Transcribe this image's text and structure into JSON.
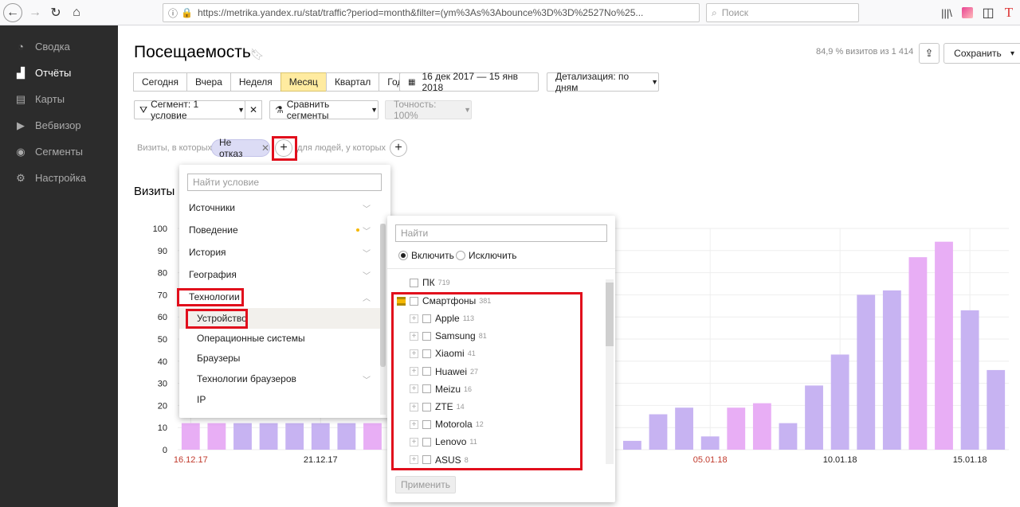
{
  "browser": {
    "url": "https://metrika.yandex.ru/stat/traffic?period=month&filter=(ym%3As%3Abounce%3D%3D%2527No%25...",
    "search_placeholder": "Поиск"
  },
  "sidebar": {
    "items": [
      {
        "label": "Сводка",
        "icon": "gauge-icon",
        "active": false
      },
      {
        "label": "Отчёты",
        "icon": "bar-chart-icon",
        "active": true
      },
      {
        "label": "Карты",
        "icon": "map-icon",
        "active": false
      },
      {
        "label": "Вебвизор",
        "icon": "play-icon",
        "active": false
      },
      {
        "label": "Сегменты",
        "icon": "segments-icon",
        "active": false
      },
      {
        "label": "Настройка",
        "icon": "gear-icon",
        "active": false
      }
    ]
  },
  "header": {
    "title": "Посещаемость",
    "visits_pct": "84,9 % визитов из 1 414",
    "save_label": "Сохранить"
  },
  "period": {
    "options": [
      "Сегодня",
      "Вчера",
      "Неделя",
      "Месяц",
      "Квартал",
      "Год"
    ],
    "selected": "Месяц",
    "date_range": "16 дек 2017 — 15 янв 2018",
    "detail": "Детализация: по дням"
  },
  "filters": {
    "segment": "Сегмент: 1 условие",
    "compare": "Сравнить сегменты",
    "accuracy": "Точность: 100%",
    "visits_label": "Визиты, в которых",
    "chip": "Не отказ",
    "people_label": "для людей, у которых"
  },
  "chart_title": "Визиты",
  "chart_data": {
    "type": "bar",
    "y_ticks": [
      "0",
      "10",
      "20",
      "30",
      "40",
      "50",
      "60",
      "70",
      "80",
      "90",
      "100"
    ],
    "ylim": [
      0,
      100
    ],
    "x_labels": [
      {
        "label": "16.12.17",
        "index": 0,
        "color": "#c0392b"
      },
      {
        "label": "21.12.17",
        "index": 5,
        "color": "#222"
      },
      {
        "label": "05.01.18",
        "index": 20,
        "color": "#c0392b"
      },
      {
        "label": "10.01.18",
        "index": 25,
        "color": "#222"
      },
      {
        "label": "15.01.18",
        "index": 30,
        "color": "#222"
      }
    ],
    "values": [
      12,
      12,
      12,
      12,
      12,
      12,
      12,
      12,
      null,
      null,
      null,
      null,
      null,
      null,
      null,
      null,
      null,
      4,
      16,
      19,
      6,
      19,
      21,
      12,
      29,
      43,
      70,
      72,
      87,
      94,
      63,
      36
    ],
    "weekend_indices": [
      0,
      1,
      7,
      8,
      14,
      15,
      21,
      22,
      28,
      29
    ]
  },
  "dropdown_groups": {
    "search_placeholder": "Найти условие",
    "items": [
      {
        "label": "Источники",
        "sub": false,
        "chev": "⌄"
      },
      {
        "label": "Поведение",
        "sub": false,
        "chev": "⌄"
      },
      {
        "label": "История",
        "sub": false,
        "chev": "⌄"
      },
      {
        "label": "География",
        "sub": false,
        "chev": "⌄"
      },
      {
        "label": "Технологии",
        "sub": false,
        "chev": "⌃"
      },
      {
        "label": "Устройство",
        "sub": true,
        "chev": ""
      },
      {
        "label": "Операционные системы",
        "sub": true,
        "chev": ""
      },
      {
        "label": "Браузеры",
        "sub": true,
        "chev": ""
      },
      {
        "label": "Технологии браузеров",
        "sub": true,
        "chev": "⌄"
      },
      {
        "label": "IP",
        "sub": true,
        "chev": ""
      }
    ]
  },
  "dropdown_values": {
    "search_placeholder": "Найти",
    "include": "Включить",
    "exclude": "Исключить",
    "pc": {
      "label": "ПК",
      "count": "719"
    },
    "phones": {
      "label": "Смартфоны",
      "count": "381"
    },
    "brands": [
      {
        "label": "Apple",
        "count": "113"
      },
      {
        "label": "Samsung",
        "count": "81"
      },
      {
        "label": "Xiaomi",
        "count": "41"
      },
      {
        "label": "Huawei",
        "count": "27"
      },
      {
        "label": "Meizu",
        "count": "16"
      },
      {
        "label": "ZTE",
        "count": "14"
      },
      {
        "label": "Motorola",
        "count": "12"
      },
      {
        "label": "Lenovo",
        "count": "11"
      },
      {
        "label": "ASUS",
        "count": "8"
      }
    ],
    "apply": "Применить"
  }
}
